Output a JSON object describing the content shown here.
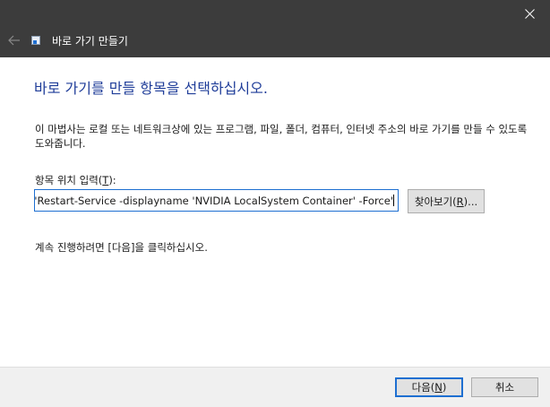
{
  "window": {
    "title": "바로 가기 만들기"
  },
  "content": {
    "heading": "바로 가기를 만들 항목을 선택하십시오.",
    "description": "이 마법사는 로컬 또는 네트워크상에 있는 프로그램, 파일, 폴더, 컴퓨터, 인터넷 주소의 바로 가기를 만들 수 있도록 도와줍니다.",
    "field_label_prefix": "항목 위치 입력(",
    "field_label_key": "T",
    "field_label_suffix": "):",
    "location_value": "nd \"Restart-Service -displayname 'NVIDIA LocalSystem Container' -Force'",
    "browse_prefix": "찾아보기(",
    "browse_key": "R",
    "browse_suffix": ")...",
    "continue_text": "계속 진행하려면 [다음]을 클릭하십시오."
  },
  "footer": {
    "next_prefix": "다음(",
    "next_key": "N",
    "next_suffix": ")",
    "cancel_label": "취소"
  },
  "icons": {
    "close": "close-icon",
    "back": "back-arrow-icon",
    "app": "shortcut-app-icon"
  },
  "colors": {
    "titlebar": "#3c3c3c",
    "heading": "#1f3d99",
    "focus": "#1e6fd1",
    "footer": "#f0f0f0"
  }
}
